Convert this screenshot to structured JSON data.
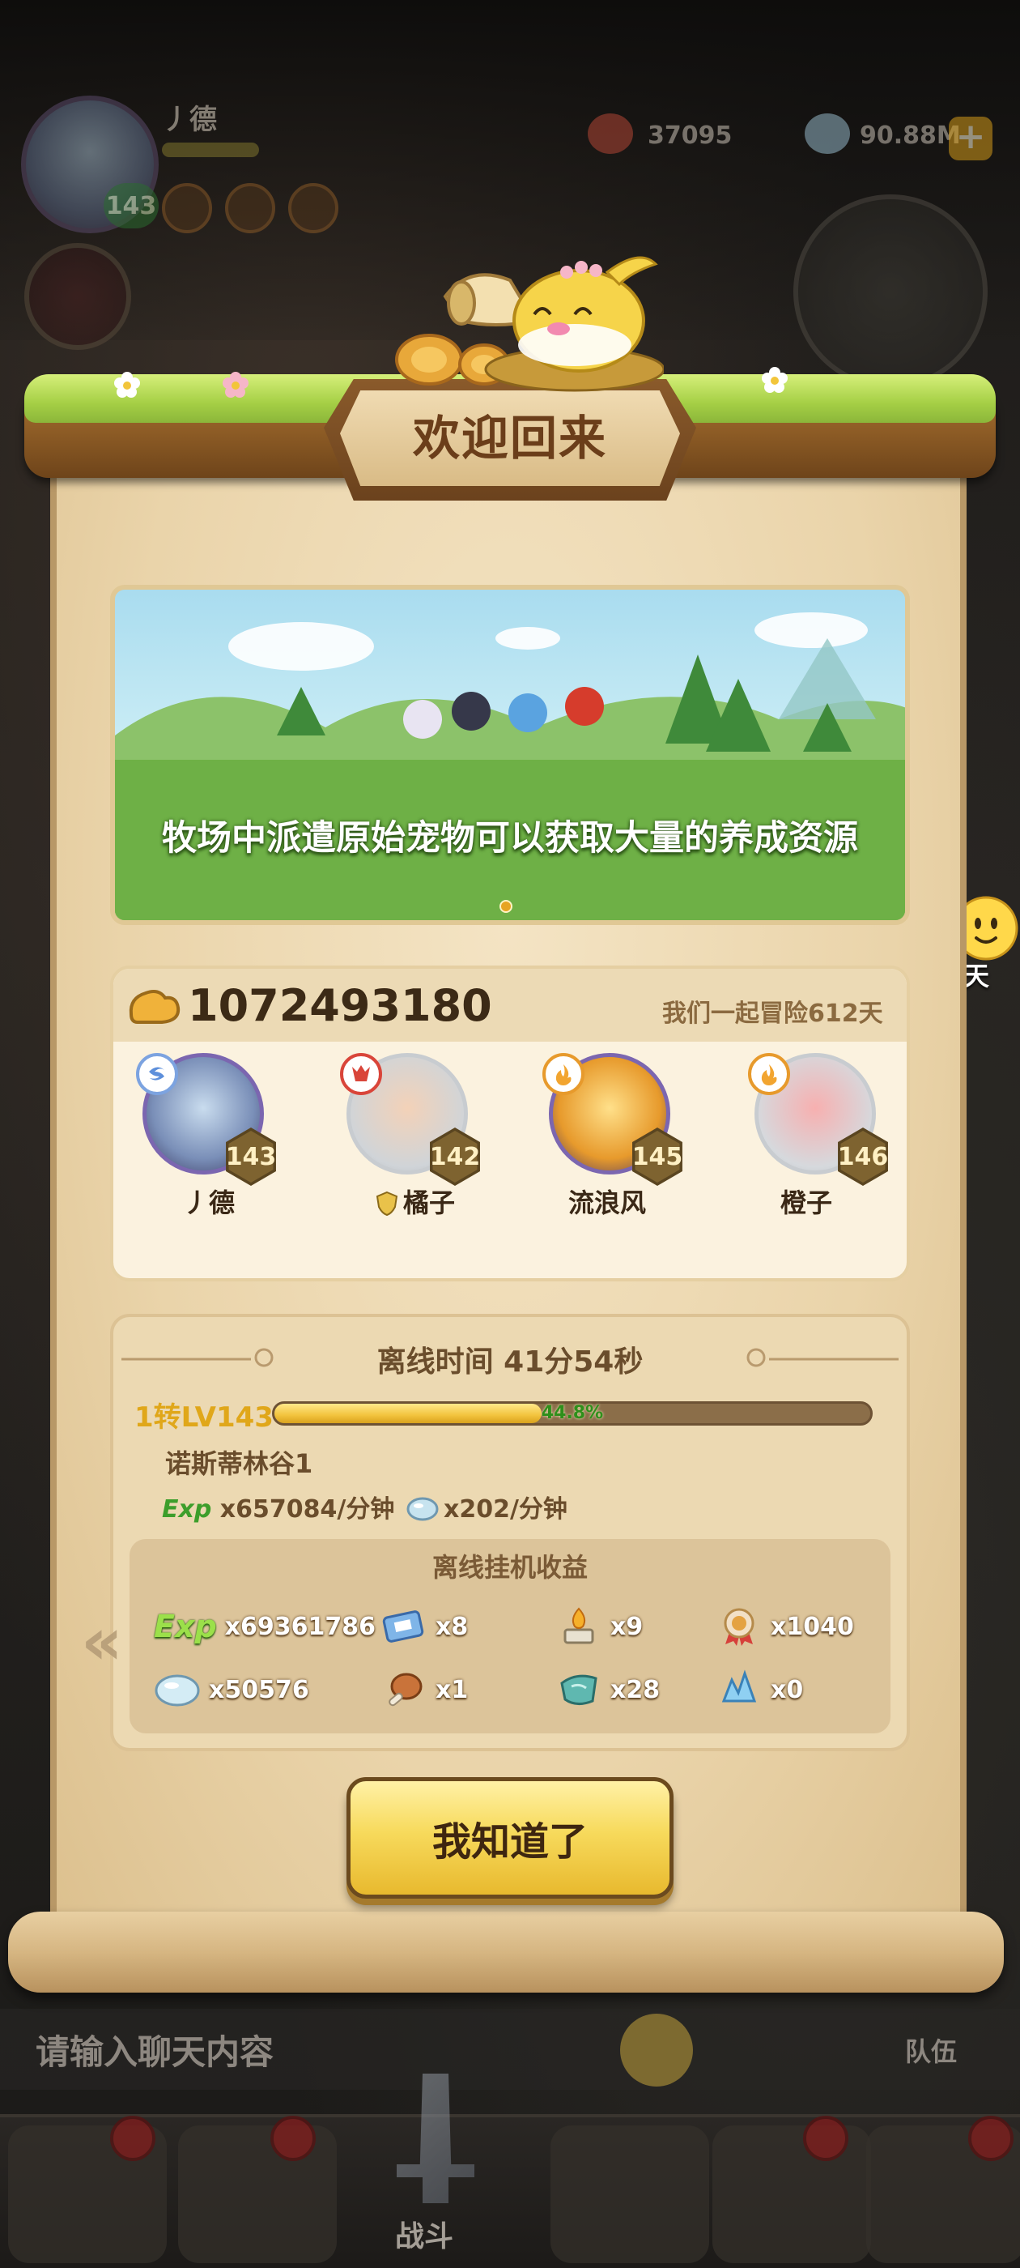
{
  "hud": {
    "player_name": "丿德",
    "player_level": "143",
    "starfish_count": "37095",
    "shell_count": "90.88M",
    "plus_label": "+",
    "right_area_label": "诺斯蒂林谷1"
  },
  "dialog": {
    "title": "欢迎回来",
    "banner_text": "牧场中派遣原始宠物可以获取大量的养成资源",
    "power": "1072493180",
    "adventure_days": "我们一起冒险612天",
    "heroes": [
      {
        "name": "丿德",
        "level": "143",
        "element": "wind",
        "accent": "#7ca3e0"
      },
      {
        "name": "橘子",
        "level": "142",
        "element": "demon",
        "accent": "#d9453a",
        "guild": true
      },
      {
        "name": "流浪风",
        "level": "145",
        "element": "fire",
        "accent": "#e79a2c"
      },
      {
        "name": "橙子",
        "level": "146",
        "element": "flame",
        "accent": "#e79a2c"
      }
    ],
    "offline": {
      "time_label": "离线时间 41分54秒",
      "rank_level": "1转LV143",
      "xp_percent": "44.8%",
      "xp_fraction": 0.448,
      "map_name": "诺斯蒂林谷1",
      "exp_tag": "Exp",
      "exp_rate": "x657084/分钟",
      "shell_rate": "x202/分钟",
      "rewards_title": "离线挂机收益",
      "rewards": [
        {
          "icon": "exp-icon",
          "label": "Exp",
          "amount": "x69361786"
        },
        {
          "icon": "ticket-icon",
          "amount": "x8"
        },
        {
          "icon": "torch-icon",
          "amount": "x9"
        },
        {
          "icon": "medal-icon",
          "amount": "x1040"
        },
        {
          "icon": "shell-icon",
          "amount": "x50576"
        },
        {
          "icon": "meat-icon",
          "amount": "x1"
        },
        {
          "icon": "scale-icon",
          "amount": "x28"
        },
        {
          "icon": "crystal-icon",
          "amount": "x0"
        }
      ]
    },
    "ok_button": "我知道了"
  },
  "chat": {
    "bubble_label": "聊天",
    "input_placeholder": "请输入聊天内容",
    "team_label": "队伍"
  },
  "nav": {
    "battle_label": "战斗"
  },
  "colors": {
    "accent_gold": "#e0a71a",
    "exp_green": "#3d9e2b",
    "button_yellow": "#f7da5c"
  }
}
